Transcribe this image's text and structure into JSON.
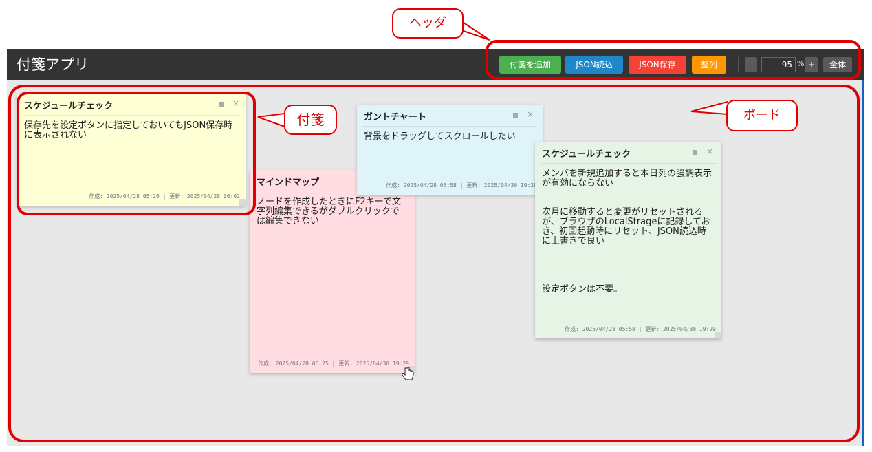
{
  "header": {
    "title": "付箋アプリ",
    "buttons": {
      "add": "付箋を追加",
      "load": "JSON読込",
      "save": "JSON保存",
      "arrange": "整列"
    },
    "zoom": {
      "minus": "-",
      "value": "95",
      "unit": "%",
      "plus": "+",
      "fit": "全体"
    }
  },
  "notes": [
    {
      "title": "スケジュールチェック",
      "body": "保存先を設定ボタンに指定しておいてもJSON保存時に表示されない",
      "footer": "作成: 2025/04/28 05:26 | 更新: 2025/04/28 06:02",
      "minimize": "■",
      "close": "×",
      "color": "#ffffd5"
    },
    {
      "title": "マインドマップ",
      "body": "ノードを作成したときにF2キーで文字列編集できるがダブルクリックでは編集できない",
      "footer": "作成: 2025/04/28 05:25 | 更新: 2025/04/30 19:29",
      "minimize": "■",
      "close": "×",
      "color": "#ffdde3"
    },
    {
      "title": "ガントチャート",
      "body": "背景をドラッグしてスクロールしたい",
      "footer": "作成: 2025/04/28 05:58 | 更新: 2025/04/30 19:29",
      "minimize": "■",
      "close": "×",
      "color": "#dff4f9"
    },
    {
      "title": "スケジュールチェック",
      "body": "メンバを新規追加すると本日列の強調表示が有効にならない\n\n\n次月に移動すると変更がリセットされるが、ブラウザのLocalStrageに記録しておき、初回起動時にリセット、JSON読込時に上書きで良い\n\n\n\n\n設定ボタンは不要。",
      "footer": "作成: 2025/04/28 05:59 | 更新: 2025/04/30 19:29",
      "minimize": "■",
      "close": "×",
      "color": "#e6f4e6"
    }
  ],
  "annotations": {
    "header_label": "ヘッダ",
    "note_label": "付箋",
    "board_label": "ボード",
    "color": "#e00000"
  }
}
